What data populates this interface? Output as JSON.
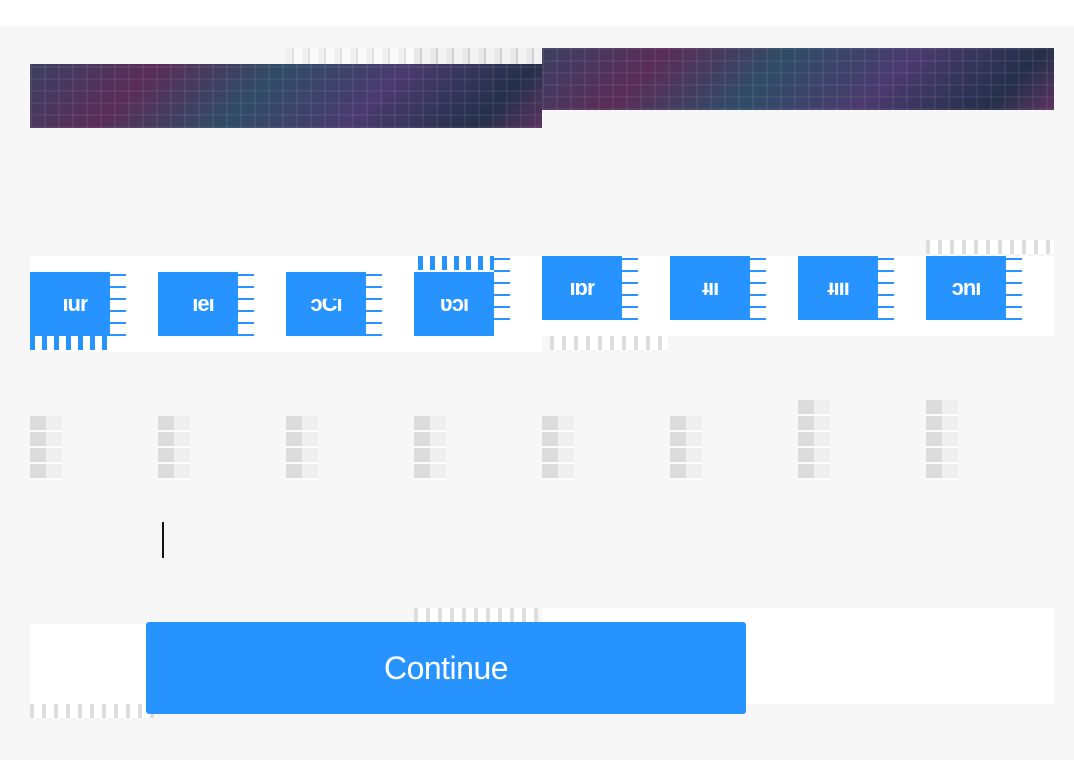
{
  "banner": {
    "icon": "captcha-image-strip"
  },
  "options": [
    {
      "label": " ıur"
    },
    {
      "label": " ıeı"
    },
    {
      "label": "ɔCı"
    },
    {
      "label": "ʋɔı"
    },
    {
      "label": "ıɒr"
    },
    {
      "label": "ʇıı"
    },
    {
      "label": "ʇıll"
    },
    {
      "label": "ɔnı"
    }
  ],
  "input": {
    "value": ""
  },
  "continue_button": {
    "label": "Continue"
  },
  "colors": {
    "accent": "#2693ff",
    "background": "#f7f7f7"
  }
}
